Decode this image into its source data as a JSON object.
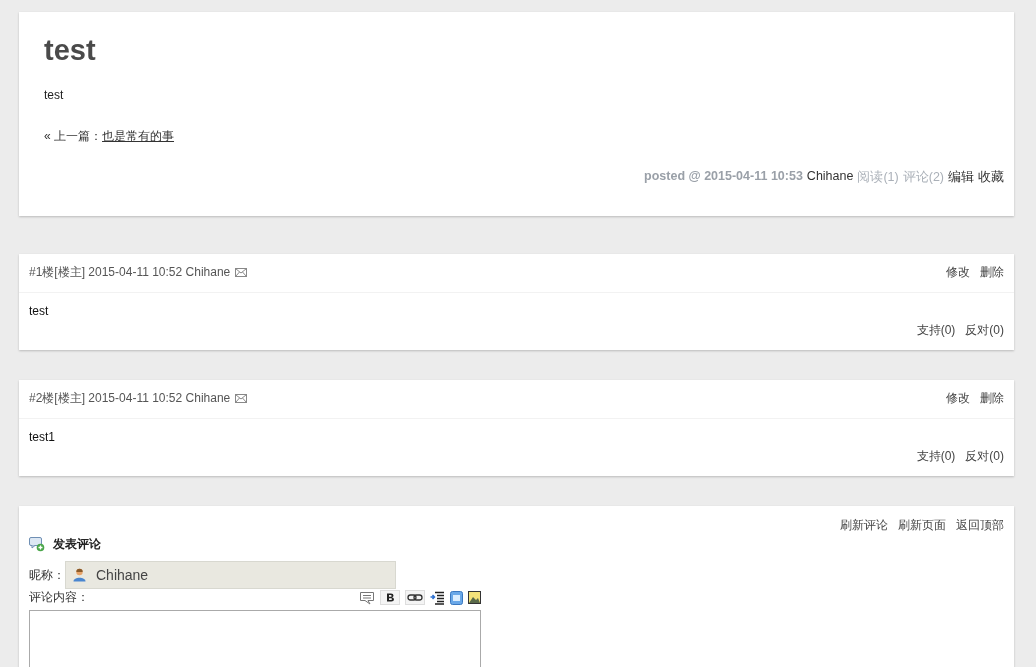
{
  "post": {
    "title": "test",
    "body": "test",
    "prev_label": "« 上一篇：",
    "prev_link": "也是常有的事",
    "footer": {
      "posted": "posted @ 2015-04-11 10:53",
      "author": "Chihane",
      "reads": "阅读(1)",
      "comments": "评论(2)",
      "edit": "编辑",
      "favorite": "收藏"
    }
  },
  "comments": [
    {
      "header": "#1楼[楼主] 2015-04-11 10:52 Chihane",
      "actions": [
        "修改",
        "删除"
      ],
      "body": "test",
      "votes": [
        "支持(0)",
        "反对(0)"
      ]
    },
    {
      "header": "#2楼[楼主] 2015-04-11 10:52 Chihane",
      "actions": [
        "修改",
        "删除"
      ],
      "body": "test1",
      "votes": [
        "支持(0)",
        "反对(0)"
      ]
    }
  ],
  "comment_form": {
    "links": [
      "刷新评论",
      "刷新页面",
      "返回顶部"
    ],
    "title": "发表评论",
    "nickname_label": "昵称：",
    "nickname": "Chihane",
    "content_label": "评论内容："
  }
}
